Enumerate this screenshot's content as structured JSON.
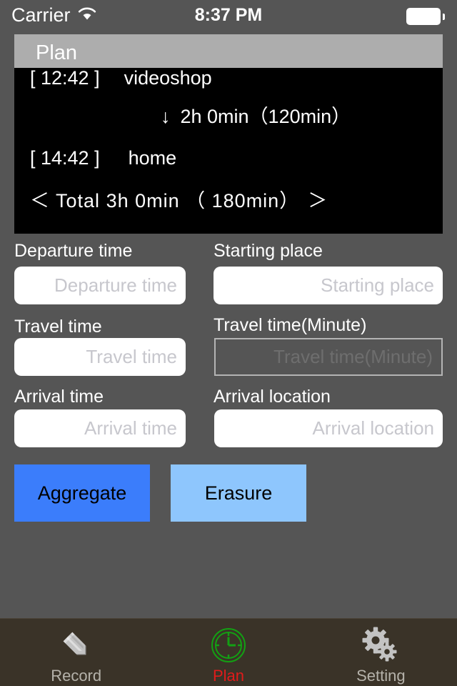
{
  "status_bar": {
    "carrier": "Carrier",
    "wifi_icon": "wifi-icon",
    "time": "8:37 PM",
    "battery_icon": "battery-icon"
  },
  "nav_bar": {
    "title": "Plan"
  },
  "schedule_panel": {
    "rows": [
      {
        "time": "[ 12:42 ]",
        "place": "videoshop"
      },
      {
        "arrow": "↓",
        "duration": "2h 0min",
        "duration_minutes": "（120min）"
      },
      {
        "time": "[ 14:42 ]",
        "place": "home"
      }
    ],
    "total": {
      "prev_chevron": "＜",
      "label": "Total",
      "duration": "3h  0min",
      "duration_minutes": "（ 180min）",
      "next_chevron": "＞"
    }
  },
  "form": {
    "departure_time": {
      "label": "Departure time",
      "placeholder": "Departure time",
      "value": ""
    },
    "starting_place": {
      "label": "Starting place",
      "placeholder": "Starting place",
      "value": ""
    },
    "travel_time": {
      "label": "Travel time",
      "placeholder": "Travel time",
      "value": ""
    },
    "travel_time_minute": {
      "label": "Travel time(Minute)",
      "placeholder": "Travel time(Minute)",
      "value": "",
      "disabled": true
    },
    "arrival_time": {
      "label": "Arrival time",
      "placeholder": "Arrival time",
      "value": ""
    },
    "arrival_location": {
      "label": "Arrival location",
      "placeholder": "Arrival location",
      "value": ""
    }
  },
  "buttons": {
    "aggregate": {
      "label": "Aggregate",
      "color": "#3b7dfb"
    },
    "erasure": {
      "label": "Erasure",
      "color": "#8ec6fd"
    }
  },
  "tab_bar": {
    "background": "#3a3328",
    "active_color": "#e01b1b",
    "inactive_color": "#b5b2aa",
    "items": [
      {
        "label": "Record",
        "icon": "pencil-icon",
        "active": false
      },
      {
        "label": "Plan",
        "icon": "clock-icon",
        "active": true
      },
      {
        "label": "Setting",
        "icon": "gears-icon",
        "active": false
      }
    ]
  }
}
